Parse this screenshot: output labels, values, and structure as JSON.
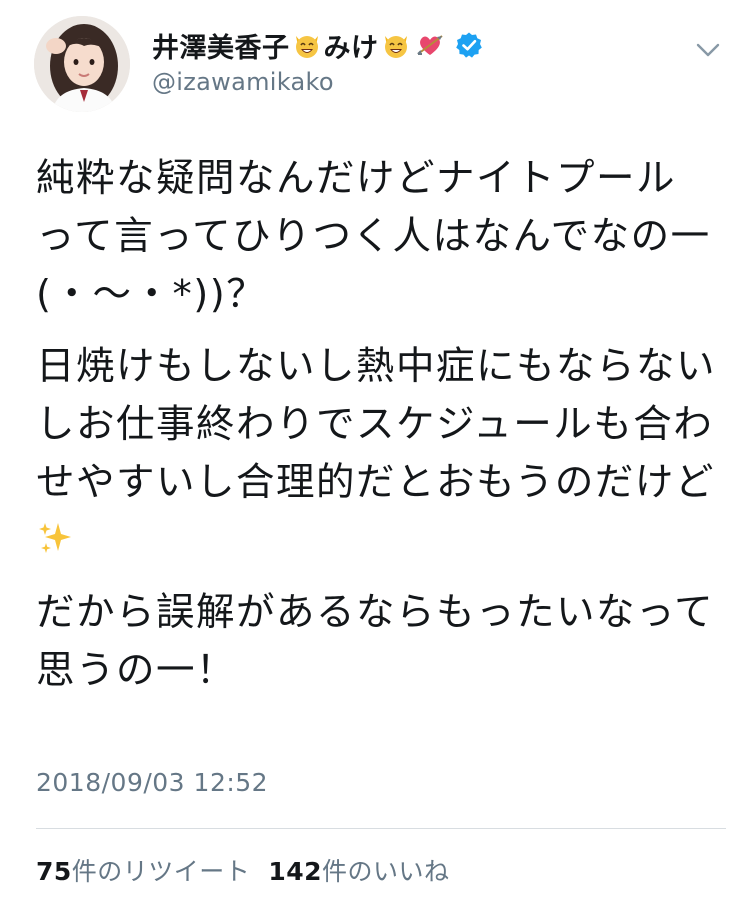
{
  "user": {
    "display_name": "井澤美香子",
    "name_suffix": "みけ",
    "handle": "@izawamikako",
    "verified": true,
    "name_emojis": [
      "cat-smile-emoji",
      "cat-smile-emoji",
      "heart-arrow-emoji"
    ]
  },
  "tweet": {
    "paragraphs": [
      "純粋な疑問なんだけどナイトプールって言ってひりつく人はなんでなの一(・〜・*))？",
      "日焼けもしないし熱中症にもならないしお仕事終わりでスケジュールも合わせやすいし合理的だとおもうのだけど",
      "だから誤解があるならもったいなって思うの一！"
    ],
    "trailing_emoji": "sparkles-emoji",
    "timestamp": "2018/09/03 12:52"
  },
  "stats": {
    "retweet_count": "75",
    "retweet_label": "件のリツイート",
    "like_count": "142",
    "like_label": "件のいいね"
  },
  "colors": {
    "text": "#14171a",
    "muted": "#657786",
    "verified_blue": "#1da1f2",
    "divider": "#d8dde1"
  }
}
